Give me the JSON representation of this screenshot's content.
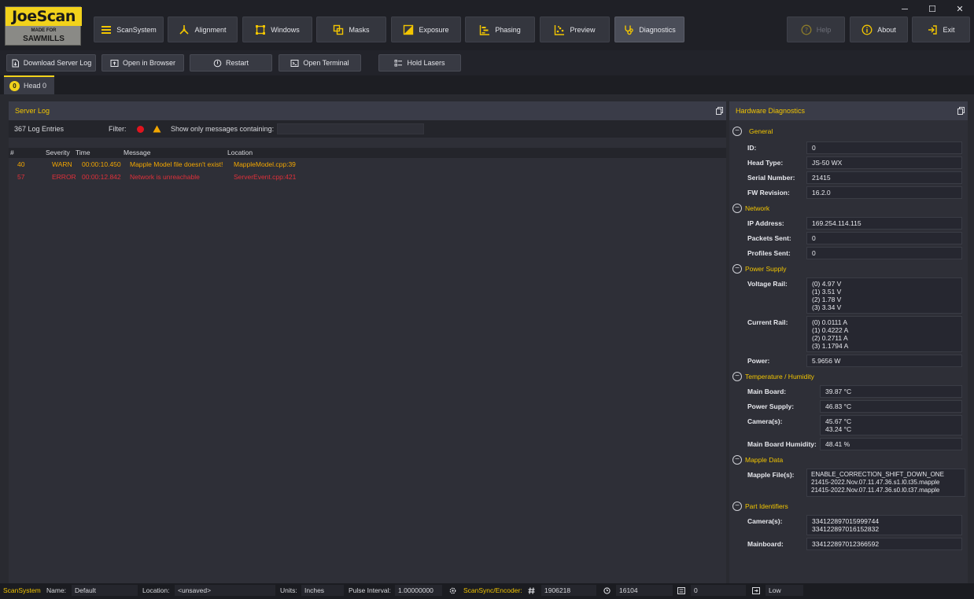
{
  "window": {
    "logo": {
      "brand": "JoeScan",
      "tagline": "MADE FOR",
      "sub": "SAWMILLS"
    },
    "controls": {
      "minimize": "─",
      "maximize": "☐",
      "close": "✕"
    }
  },
  "nav": {
    "scansystem": "ScanSystem",
    "alignment": "Alignment",
    "windows": "Windows",
    "masks": "Masks",
    "exposure": "Exposure",
    "phasing": "Phasing",
    "preview": "Preview",
    "diagnostics": "Diagnostics",
    "help": "Help",
    "about": "About",
    "exit": "Exit"
  },
  "toolbar": {
    "download": "Download Server Log",
    "open_browser": "Open in Browser",
    "restart": "Restart",
    "open_terminal": "Open Terminal",
    "hold_lasers": "Hold Lasers"
  },
  "head_tab": {
    "number": "0",
    "label": "Head 0"
  },
  "server_log": {
    "title": "Server Log",
    "count": "367 Log Entries",
    "filter_label": "Filter:",
    "search_label": "Show only messages containing:",
    "search_value": "",
    "columns": {
      "num": "#",
      "severity": "Severity",
      "time": "Time",
      "message": "Message",
      "location": "Location"
    },
    "rows": [
      {
        "num": "40",
        "severity": "WARN",
        "time": "00:00:10.450",
        "message": "Mapple Model file doesn't exist!",
        "location": "MappleModel.cpp:39"
      },
      {
        "num": "57",
        "severity": "ERROR",
        "time": "00:00:12.842",
        "message": "Network is unreachable",
        "location": "ServerEvent.cpp:421"
      }
    ]
  },
  "hardware": {
    "title": "Hardware Diagnostics",
    "sections": {
      "general": "General",
      "network": "Network",
      "power": "Power Supply",
      "temp": "Temperature / Humidity",
      "mapple": "Mapple Data",
      "part": "Part Identifiers"
    },
    "labels": {
      "id": "ID:",
      "head_type": "Head Type:",
      "serial": "Serial Number:",
      "fw": "FW Revision:",
      "ip": "IP Address:",
      "packets": "Packets Sent:",
      "profiles": "Profiles Sent:",
      "voltage": "Voltage Rail:",
      "current": "Current Rail:",
      "power": "Power:",
      "main_board": "Main Board:",
      "power_supply": "Power Supply:",
      "cameras": "Camera(s):",
      "humidity": "Main Board Humidity:",
      "mapple_files": "Mapple File(s):",
      "part_cameras": "Camera(s):",
      "mainboard": "Mainboard:"
    },
    "values": {
      "id": "0",
      "head_type": "JS-50 WX",
      "serial": "21415",
      "fw": "16.2.0",
      "ip": "169.254.114.115",
      "packets": "0",
      "profiles": "0",
      "voltage": [
        "(0) 4.97 V",
        "(1) 3.51 V",
        "(2) 1.78 V",
        "(3) 3.34 V"
      ],
      "current": [
        "(0) 0.0111 A",
        "(1) 0.4222 A",
        "(2) 0.2711 A",
        "(3) 1.1794 A"
      ],
      "power": "5.9656 W",
      "main_board": "39.87 °C",
      "power_supply": "46.83 °C",
      "cameras": [
        "45.67 °C",
        "43.24 °C"
      ],
      "humidity": "48.41 %",
      "mapple_files": [
        "ENABLE_CORRECTION_SHIFT_DOWN_ONE",
        "21415-2022.Nov.07.11.47.36.s1.l0.t35.mapple",
        "21415-2022.Nov.07.11.47.36.s0.l0.t37.mapple"
      ],
      "part_cameras": [
        "334122897015999744",
        "334122897016152832"
      ],
      "mainboard": "334122897012366592"
    }
  },
  "status": {
    "scansystem": "ScanSystem",
    "name_label": "Name:",
    "name_value": "Default",
    "location_label": "Location:",
    "location_value": "<unsaved>",
    "units_label": "Units:",
    "units_value": "Inches",
    "pulse_label": "Pulse Interval:",
    "pulse_value": "1.00000000",
    "sync_label": "ScanSync/Encoder:",
    "encoder": "1906218",
    "time": "16104",
    "count": "0",
    "level": "Low"
  },
  "colors": {
    "accent": "#f2c500",
    "warn": "#f2a600",
    "error": "#e0303a",
    "bg": "#2b2c33"
  }
}
